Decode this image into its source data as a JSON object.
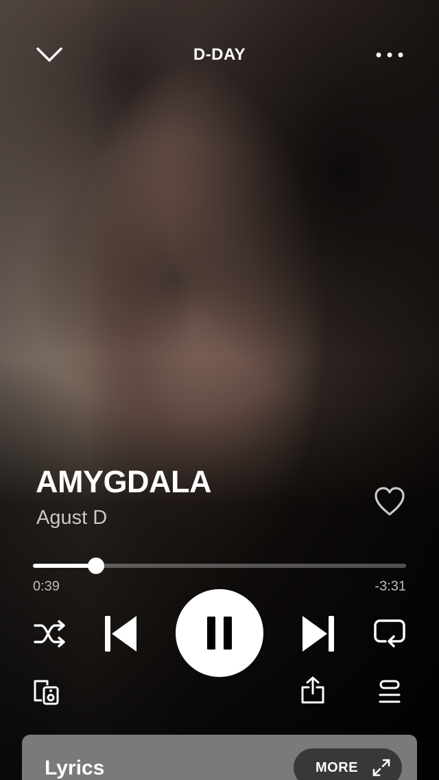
{
  "header": {
    "album": "D-DAY"
  },
  "track": {
    "title": "AMYGDALA",
    "artist": "Agust D"
  },
  "playback": {
    "elapsed": "0:39",
    "remaining": "-3:31",
    "progress_fraction": 0.169,
    "state": "playing"
  },
  "icons": {
    "collapse": "chevron-down-icon",
    "menu": "more-icon",
    "like": "heart-icon",
    "shuffle": "shuffle-icon",
    "previous": "skip-previous-icon",
    "play_pause": "pause-icon",
    "next": "skip-next-icon",
    "repeat": "repeat-icon",
    "devices": "devices-icon",
    "share": "share-icon",
    "queue": "queue-icon",
    "expand": "expand-icon"
  },
  "lyrics": {
    "label": "Lyrics",
    "more_label": "MORE"
  },
  "colors": {
    "lyrics_card": "#7a7a7a",
    "more_button": "#383838"
  }
}
